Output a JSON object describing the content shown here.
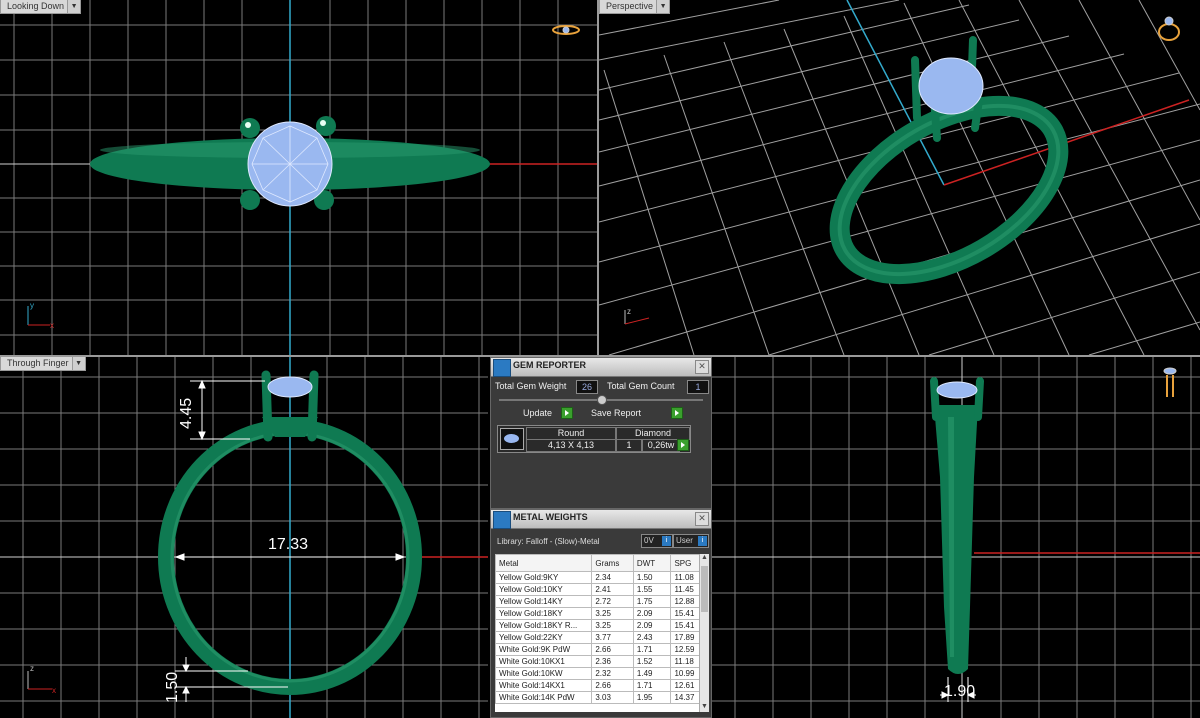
{
  "viewports": {
    "top_left": {
      "label": "Looking Down"
    },
    "top_right": {
      "label": "Perspective"
    },
    "bottom_left": {
      "label": "Through Finger"
    }
  },
  "dimensions": {
    "prong_height": "4.45",
    "inner_diameter": "17.33",
    "band_thickness": "1.50",
    "band_width": "1.90"
  },
  "gem_reporter": {
    "title": "GEM REPORTER",
    "total_weight_label": "Total Gem Weight",
    "total_weight_value": "26",
    "total_count_label": "Total Gem Count",
    "total_count_value": "1",
    "update_label": "Update",
    "save_report_label": "Save Report",
    "gem": {
      "shape": "Round",
      "size": "4,13 X 4,13",
      "type": "Diamond",
      "count": "1",
      "weight": "0,26tw"
    }
  },
  "metal_weights": {
    "title": "METAL WEIGHTS",
    "library_label": "Library: Falloff - (Slow)-Metal",
    "btn_0v": "0V",
    "btn_user": "User",
    "columns": [
      "Metal",
      "Grams",
      "DWT",
      "SPG"
    ],
    "rows": [
      [
        "Yellow Gold:9KY",
        "2.34",
        "1.50",
        "11.08"
      ],
      [
        "Yellow Gold:10KY",
        "2.41",
        "1.55",
        "11.45"
      ],
      [
        "Yellow Gold:14KY",
        "2.72",
        "1.75",
        "12.88"
      ],
      [
        "Yellow Gold:18KY",
        "3.25",
        "2.09",
        "15.41"
      ],
      [
        "Yellow Gold:18KY R...",
        "3.25",
        "2.09",
        "15.41"
      ],
      [
        "Yellow Gold:22KY",
        "3.77",
        "2.43",
        "17.89"
      ],
      [
        "White Gold:9K PdW",
        "2.66",
        "1.71",
        "12.59"
      ],
      [
        "White Gold:10KX1",
        "2.36",
        "1.52",
        "11.18"
      ],
      [
        "White Gold:10KW",
        "2.32",
        "1.49",
        "10.99"
      ],
      [
        "White Gold:14KX1",
        "2.66",
        "1.71",
        "12.61"
      ],
      [
        "White Gold:14K PdW",
        "3.03",
        "1.95",
        "14.37"
      ]
    ]
  },
  "colors": {
    "metal": "#0f7a52",
    "gem": "#9ab8f0",
    "grid": "#8a8a8a",
    "x_axis": "#cc2222",
    "y_axis": "#33aacc"
  }
}
